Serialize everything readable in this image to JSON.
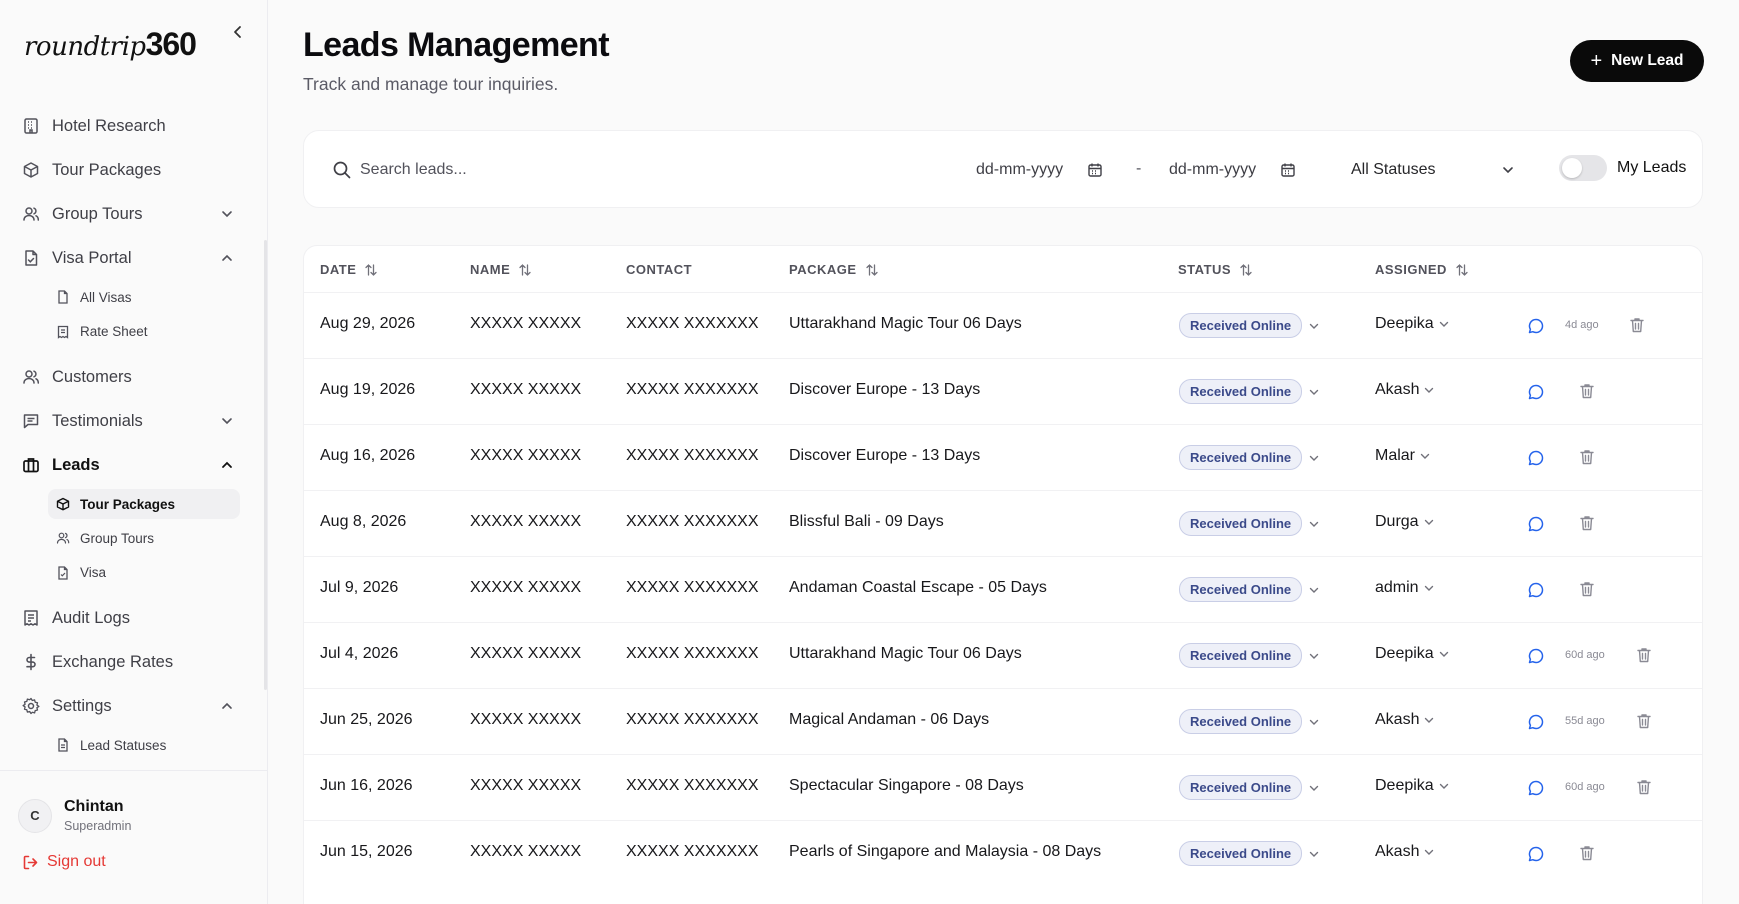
{
  "brand": {
    "logo_script": "roundtrip",
    "logo_bold": "360"
  },
  "sidebar": {
    "items": [
      {
        "label": "Hotel Research"
      },
      {
        "label": "Tour Packages"
      },
      {
        "label": "Group Tours"
      },
      {
        "label": "Visa Portal"
      },
      {
        "label": "All Visas"
      },
      {
        "label": "Rate Sheet"
      },
      {
        "label": "Customers"
      },
      {
        "label": "Testimonials"
      },
      {
        "label": "Leads"
      },
      {
        "label": "Tour Packages"
      },
      {
        "label": "Group Tours"
      },
      {
        "label": "Visa"
      },
      {
        "label": "Audit Logs"
      },
      {
        "label": "Exchange Rates"
      },
      {
        "label": "Settings"
      },
      {
        "label": "Lead Statuses"
      }
    ],
    "active_item": "Leads",
    "active_sub_item": "Tour Packages"
  },
  "user": {
    "initial": "C",
    "name": "Chintan",
    "role": "Superadmin",
    "signout_label": "Sign out"
  },
  "header": {
    "title": "Leads Management",
    "subtitle": "Track and manage tour inquiries.",
    "new_button_label": "New Lead"
  },
  "filters": {
    "search_placeholder": "Search leads...",
    "date_from_placeholder": "dd-mm-yyyy",
    "date_to_placeholder": "dd-mm-yyyy",
    "date_separator": "-",
    "status_selected": "All Statuses",
    "my_leads_label": "My Leads",
    "my_leads_on": false
  },
  "table": {
    "columns": [
      "DATE",
      "NAME",
      "CONTACT",
      "PACKAGE",
      "STATUS",
      "ASSIGNED"
    ],
    "rows": [
      {
        "date": "Aug 29, 2026",
        "name": "XXXXX XXXXX",
        "contact": "XXXXX XXXXXXX",
        "package": "Uttarakhand Magic Tour 06 Days",
        "status": "Received Online",
        "assigned": "Deepika",
        "ago": "4d ago"
      },
      {
        "date": "Aug 19, 2026",
        "name": "XXXXX XXXXX",
        "contact": "XXXXX XXXXXXX",
        "package": "Discover Europe - 13 Days",
        "status": "Received Online",
        "assigned": "Akash",
        "ago": ""
      },
      {
        "date": "Aug 16, 2026",
        "name": "XXXXX XXXXX",
        "contact": "XXXXX XXXXXXX",
        "package": "Discover Europe - 13 Days",
        "status": "Received Online",
        "assigned": "Malar",
        "ago": ""
      },
      {
        "date": "Aug 8, 2026",
        "name": "XXXXX XXXXX",
        "contact": "XXXXX XXXXXXX",
        "package": "Blissful Bali - 09 Days",
        "status": "Received Online",
        "assigned": "Durga",
        "ago": ""
      },
      {
        "date": "Jul 9, 2026",
        "name": "XXXXX XXXXX",
        "contact": "XXXXX XXXXXXX",
        "package": "Andaman Coastal Escape - 05 Days",
        "status": "Received Online",
        "assigned": "admin",
        "ago": ""
      },
      {
        "date": "Jul 4, 2026",
        "name": "XXXXX XXXXX",
        "contact": "XXXXX XXXXXXX",
        "package": "Uttarakhand Magic Tour 06 Days",
        "status": "Received Online",
        "assigned": "Deepika",
        "ago": "60d ago"
      },
      {
        "date": "Jun 25, 2026",
        "name": "XXXXX XXXXX",
        "contact": "XXXXX XXXXXXX",
        "package": "Magical Andaman - 06 Days",
        "status": "Received Online",
        "assigned": "Akash",
        "ago": "55d ago"
      },
      {
        "date": "Jun 16, 2026",
        "name": "XXXXX XXXXX",
        "contact": "XXXXX XXXXXXX",
        "package": "Spectacular Singapore - 08 Days",
        "status": "Received Online",
        "assigned": "Deepika",
        "ago": "60d ago"
      },
      {
        "date": "Jun 15, 2026",
        "name": "XXXXX XXXXX",
        "contact": "XXXXX XXXXXXX",
        "package": "Pearls of Singapore and Malaysia - 08 Days",
        "status": "Received Online",
        "assigned": "Akash",
        "ago": ""
      }
    ]
  },
  "colors": {
    "accent": "#0a0a0a",
    "badge_text": "#3b4a8a",
    "badge_bg": "#eef0f8",
    "chat_icon": "#2563eb",
    "signout": "#e53935"
  }
}
